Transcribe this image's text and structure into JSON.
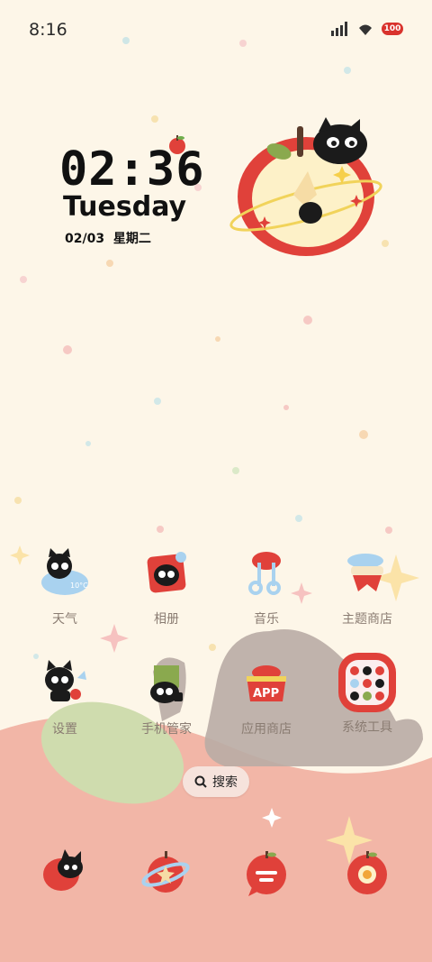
{
  "status": {
    "time": "8:16",
    "battery": "100"
  },
  "clock": {
    "time": "02:36",
    "weekday": "Tuesday",
    "date": "02/03  星期二"
  },
  "apps_row1": [
    {
      "label": "天气",
      "icon": "weather-icon"
    },
    {
      "label": "相册",
      "icon": "gallery-icon"
    },
    {
      "label": "音乐",
      "icon": "music-icon"
    },
    {
      "label": "主题商店",
      "icon": "theme-store-icon"
    }
  ],
  "apps_row2": [
    {
      "label": "设置",
      "icon": "settings-icon"
    },
    {
      "label": "手机管家",
      "icon": "phone-manager-icon"
    },
    {
      "label": "应用商店",
      "icon": "app-store-icon"
    },
    {
      "label": "系统工具",
      "icon": "system-tools-icon"
    }
  ],
  "weather_badge": "10°C",
  "app_store_badge": "APP",
  "search": {
    "label": "搜索"
  },
  "dock": [
    "phone-icon",
    "browser-icon",
    "messages-icon",
    "camera-icon"
  ],
  "colors": {
    "background": "#fdf6e8",
    "hill": "#f1b8a8",
    "apple_red": "#e0413a",
    "cat": "#1b1b1b",
    "label": "#8a7c72"
  }
}
